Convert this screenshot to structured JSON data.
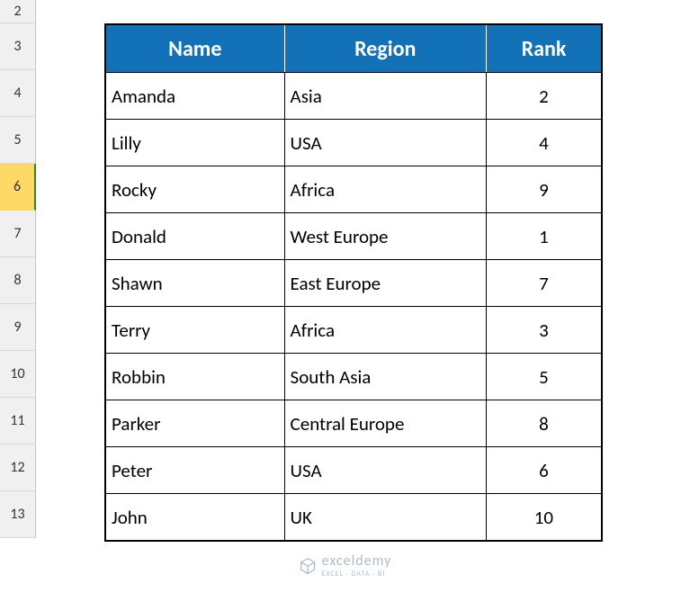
{
  "rowHeaders": [
    "2",
    "3",
    "4",
    "5",
    "6",
    "7",
    "8",
    "9",
    "10",
    "11",
    "12",
    "13"
  ],
  "selectedRow": "6",
  "headers": {
    "name": "Name",
    "region": "Region",
    "rank": "Rank"
  },
  "rows": [
    {
      "name": "Amanda",
      "region": "Asia",
      "rank": "2"
    },
    {
      "name": "Lilly",
      "region": "USA",
      "rank": "4"
    },
    {
      "name": "Rocky",
      "region": "Africa",
      "rank": "9"
    },
    {
      "name": "Donald",
      "region": "West Europe",
      "rank": "1"
    },
    {
      "name": "Shawn",
      "region": "East Europe",
      "rank": "7"
    },
    {
      "name": "Terry",
      "region": "Africa",
      "rank": "3"
    },
    {
      "name": "Robbin",
      "region": "South Asia",
      "rank": "5"
    },
    {
      "name": "Parker",
      "region": "Central Europe",
      "rank": "8"
    },
    {
      "name": "Peter",
      "region": "USA",
      "rank": "6"
    },
    {
      "name": "John",
      "region": "UK",
      "rank": "10"
    }
  ],
  "watermark": {
    "brand": "exceldemy",
    "sub": "EXCEL · DATA · BI"
  }
}
